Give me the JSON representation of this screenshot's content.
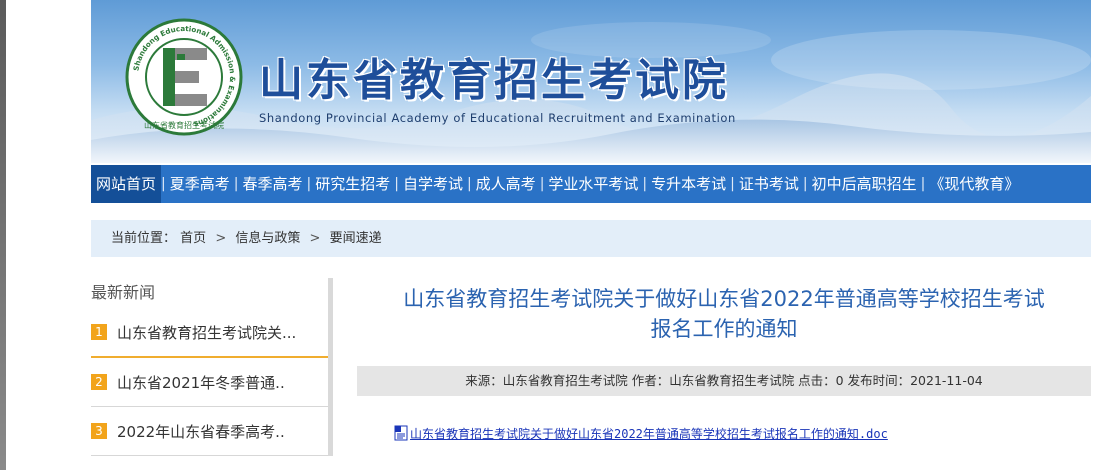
{
  "colors": {
    "nav_bg": "#2a72c6",
    "nav_active_bg": "#144f98",
    "breadcrumb_bg": "#e3eef9",
    "accent_orange": "#f2a41b",
    "title_blue": "#2b63b0",
    "link_blue": "#1a35b8"
  },
  "header": {
    "title": "山东省教育招生考试院",
    "subtitle": "Shandong Provincial Academy of Educational Recruitment and Examination",
    "logo_ring_text": "Shandong Educational Admission & Examinations",
    "logo_cn_text": "山东省教育招生考试院",
    "logo_icon": "letter-e-logo-icon"
  },
  "nav": {
    "items": [
      {
        "label": "网站首页"
      },
      {
        "label": "夏季高考"
      },
      {
        "label": "春季高考"
      },
      {
        "label": "研究生招考"
      },
      {
        "label": "自学考试"
      },
      {
        "label": "成人高考"
      },
      {
        "label": "学业水平考试"
      },
      {
        "label": "专升本考试"
      },
      {
        "label": "证书考试"
      },
      {
        "label": "初中后高职招生"
      },
      {
        "label": "《现代教育》"
      }
    ],
    "separator": "|"
  },
  "breadcrumb": {
    "prefix": "当前位置：",
    "items": [
      "首页",
      "信息与政策",
      "要闻速递"
    ],
    "separator": ">"
  },
  "sidebar": {
    "heading": "最新新闻",
    "items": [
      {
        "num": "1",
        "text": "山东省教育招生考试院关..."
      },
      {
        "num": "2",
        "text": "山东省2021年冬季普通.."
      },
      {
        "num": "3",
        "text": "2022年山东省春季高考.."
      }
    ]
  },
  "article": {
    "title_line1": "山东省教育招生考试院关于做好山东省2022年普通高等学校招生考试",
    "title_line2": "报名工作的通知",
    "meta": "来源：山东省教育招生考试院 作者：山东省教育招生考试院 点击：0 发布时间：2021-11-04",
    "attachment": "山东省教育招生考试院关于做好山东省2022年普通高等学校招生考试报名工作的通知.doc",
    "attachment_icon": "word-doc-icon"
  }
}
